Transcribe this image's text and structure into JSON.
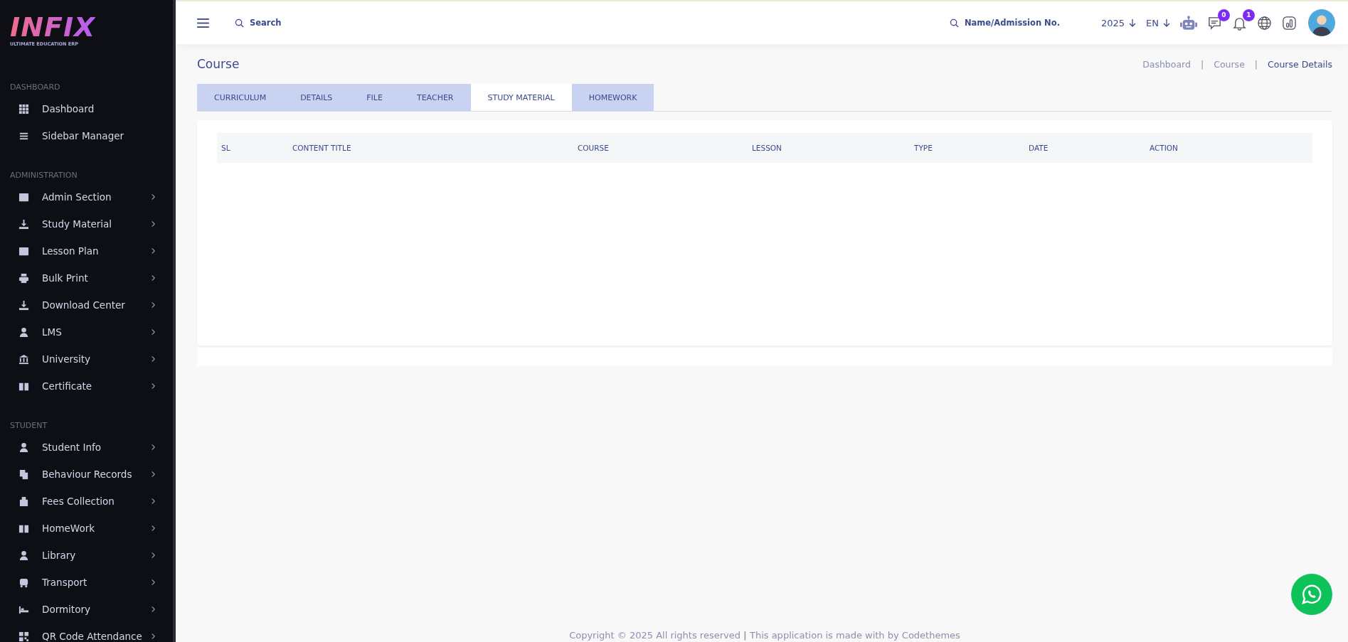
{
  "logo": {
    "name": "INFIX",
    "tagline": "ULTIMATE EDUCATION ERP"
  },
  "sidebar": {
    "sections": [
      {
        "title": "DASHBOARD",
        "items": [
          {
            "label": "Dashboard",
            "has_submenu": false
          },
          {
            "label": "Sidebar Manager",
            "has_submenu": false
          }
        ]
      },
      {
        "title": "ADMINISTRATION",
        "items": [
          {
            "label": "Admin Section",
            "has_submenu": true
          },
          {
            "label": "Study Material",
            "has_submenu": true
          },
          {
            "label": "Lesson Plan",
            "has_submenu": true
          },
          {
            "label": "Bulk Print",
            "has_submenu": true
          },
          {
            "label": "Download Center",
            "has_submenu": true
          },
          {
            "label": "LMS",
            "has_submenu": true
          },
          {
            "label": "University",
            "has_submenu": true
          },
          {
            "label": "Certificate",
            "has_submenu": true
          }
        ]
      },
      {
        "title": "STUDENT",
        "items": [
          {
            "label": "Student Info",
            "has_submenu": true
          },
          {
            "label": "Behaviour Records",
            "has_submenu": true
          },
          {
            "label": "Fees Collection",
            "has_submenu": true
          },
          {
            "label": "HomeWork",
            "has_submenu": true
          },
          {
            "label": "Library",
            "has_submenu": true
          },
          {
            "label": "Transport",
            "has_submenu": true
          },
          {
            "label": "Dormitory",
            "has_submenu": true
          },
          {
            "label": "QR Code Attendance",
            "has_submenu": true
          }
        ]
      }
    ]
  },
  "header": {
    "search": {
      "placeholder": "Search"
    },
    "student_search": {
      "placeholder": "Name/Admission No."
    },
    "year": "2025",
    "language": "EN",
    "messages_badge": "0",
    "notifications_badge": "1"
  },
  "page": {
    "title": "Course",
    "breadcrumb_separator": "|",
    "breadcrumbs": [
      {
        "label": "Dashboard",
        "current": false
      },
      {
        "label": "Course",
        "current": false
      },
      {
        "label": "Course Details",
        "current": true
      }
    ]
  },
  "tabs": [
    {
      "label": "CURRICULUM",
      "selected": false
    },
    {
      "label": "DETAILS",
      "selected": false
    },
    {
      "label": "FILE",
      "selected": false
    },
    {
      "label": "TEACHER",
      "selected": false
    },
    {
      "label": "STUDY MATERIAL",
      "selected": true
    },
    {
      "label": "HOMEWORK",
      "selected": false
    }
  ],
  "table": {
    "columns": [
      "SL",
      "CONTENT TITLE",
      "COURSE",
      "LESSON",
      "TYPE",
      "DATE",
      "ACTION"
    ]
  },
  "footer": {
    "text": "Copyright © 2025 All rights reserved **|** This application is made with by Codethemes"
  }
}
